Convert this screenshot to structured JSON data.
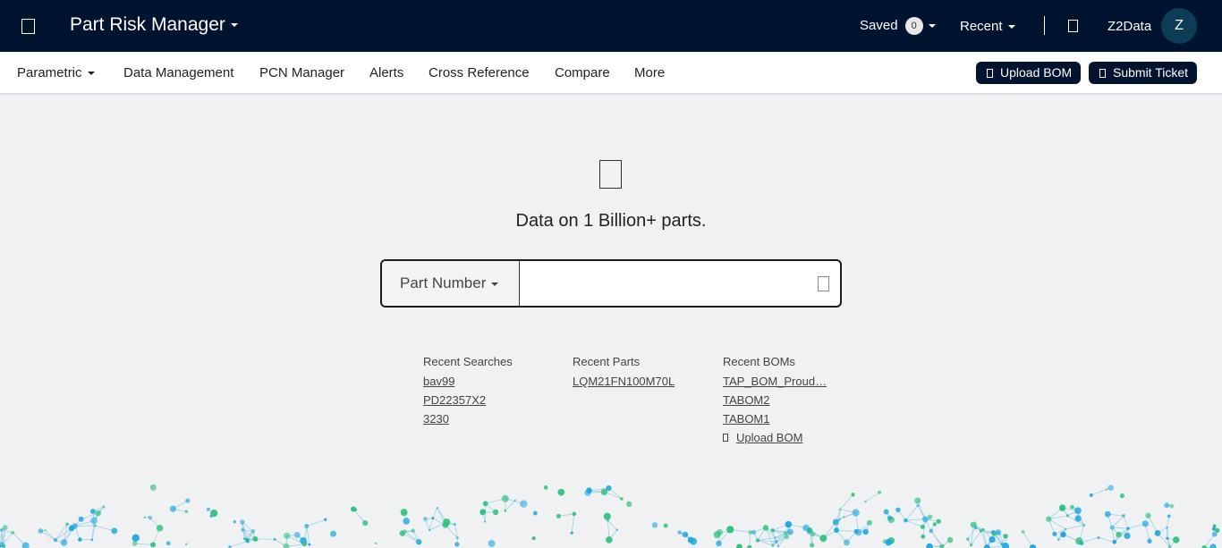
{
  "topbar": {
    "app_title": "Part Risk Manager",
    "saved_label": "Saved",
    "saved_count": "0",
    "recent_label": "Recent",
    "org_name": "Z2Data",
    "avatar_initial": "Z"
  },
  "nav": {
    "items": [
      "Parametric",
      "Data Management",
      "PCN Manager",
      "Alerts",
      "Cross Reference",
      "Compare",
      "More"
    ],
    "upload_bom": "Upload BOM",
    "submit_ticket": "Submit Ticket"
  },
  "main": {
    "tagline": "Data on 1 Billion+ parts.",
    "search": {
      "type_label": "Part Number",
      "value": "",
      "placeholder": ""
    },
    "recent_searches": {
      "title": "Recent Searches",
      "items": [
        "bav99",
        "PD22357X2",
        "3230"
      ]
    },
    "recent_parts": {
      "title": "Recent Parts",
      "items": [
        "LQM21FN100M70L"
      ]
    },
    "recent_boms": {
      "title": "Recent BOMs",
      "items": [
        "TAP_BOM_Proud…",
        "TABOM2",
        "TABOM1"
      ],
      "upload_label": "Upload BOM"
    }
  },
  "colors": {
    "header_bg": "#00142f",
    "page_bg": "#f0f1f3",
    "avatar_bg": "#0c3c56",
    "network_blue": "#1ea7e0",
    "network_green": "#2ec27e"
  }
}
